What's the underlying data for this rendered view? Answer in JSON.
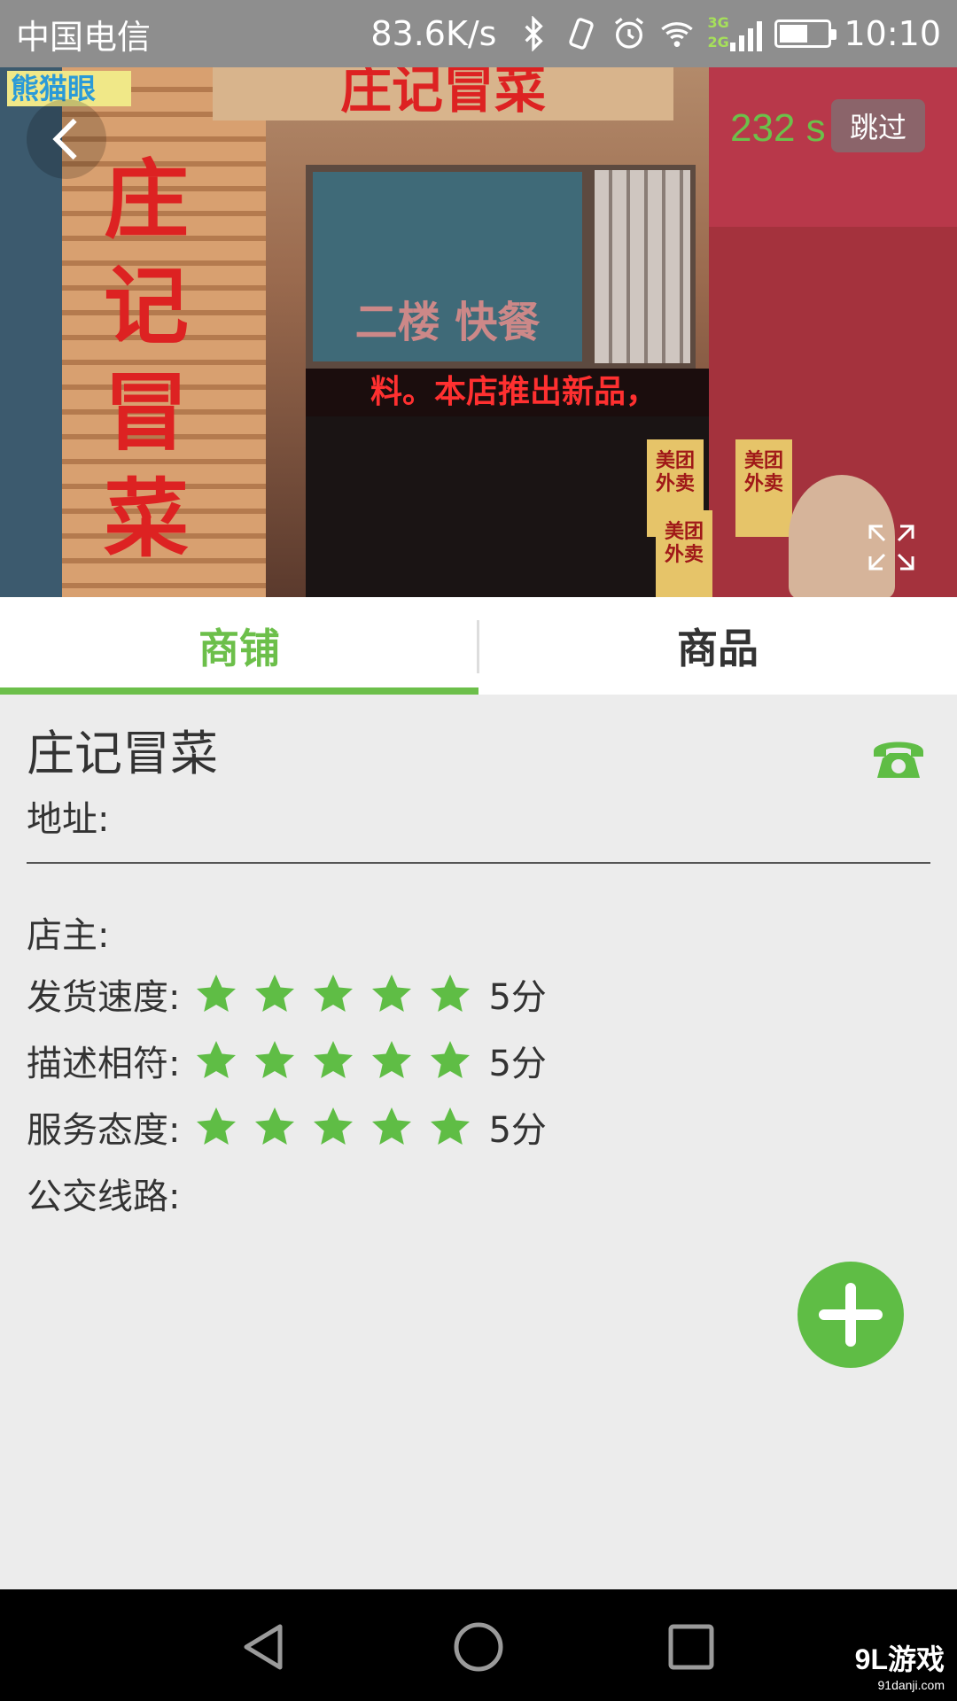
{
  "status_bar": {
    "carrier": "中国电信",
    "speed": "83.6K/s",
    "network_3g": "3G",
    "network_2g": "2G",
    "battery_level": 0.6,
    "time": "10:10"
  },
  "hero": {
    "countdown": "232 s",
    "skip_label": "跳过",
    "brand_logo": "熊猫眼",
    "top_sign": "庄记冒菜",
    "vertical_sign": "庄记冒菜",
    "window_text": "二楼 快餐",
    "led_text": "料。本店推出新品，",
    "poster_text": "美团外卖",
    "icons": {
      "back": "chevron-left-icon",
      "fullscreen": "expand-icon"
    }
  },
  "tabs": [
    {
      "label": "商铺",
      "active": true
    },
    {
      "label": "商品",
      "active": false
    }
  ],
  "shop": {
    "name": "庄记冒菜",
    "address_label": "地址:",
    "owner_label": "店主:",
    "ratings": [
      {
        "label": "发货速度:",
        "stars": 5,
        "max": 5,
        "score_text": "5分"
      },
      {
        "label": "描述相符:",
        "stars": 5,
        "max": 5,
        "score_text": "5分"
      },
      {
        "label": "服务态度:",
        "stars": 5,
        "max": 5,
        "score_text": "5分"
      }
    ],
    "bus_label": "公交线路:"
  },
  "colors": {
    "accent": "#6cbf4a",
    "fab": "#5fbd45",
    "status_bar": "#8e8e8e",
    "background": "#ececec"
  },
  "watermark": {
    "main": "9L游戏",
    "sub": "91danji.com"
  }
}
